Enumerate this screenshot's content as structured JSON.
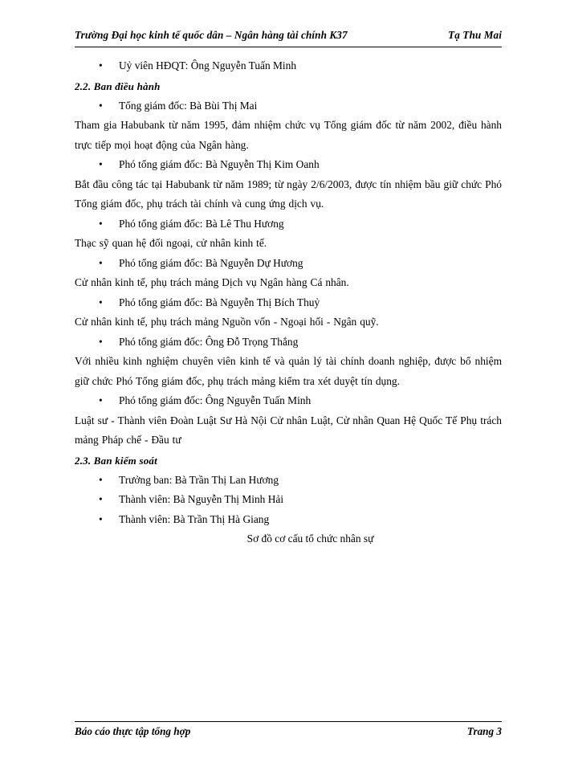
{
  "header": {
    "left": "Trường Đại học kinh tế quốc dân – Ngân hàng tài chính K37",
    "right": "Tạ Thu Mai"
  },
  "footer": {
    "left": "Báo cáo thực tập tổng hợp",
    "right": "Trang 3"
  },
  "bullet_glyph": "•",
  "body": {
    "b_uy_vien": "Uỷ viên HĐQT: Ông Nguyễn Tuấn Minh",
    "h_2_2": "2.2. Ban điều hành",
    "b_tong_giam_doc": "Tổng giám đốc: Bà Bùi Thị Mai",
    "p_tham_gia": "Tham gia Habubank từ năm 1995, đảm nhiệm chức vụ Tổng giám đốc từ năm 2002, điều hành trực tiếp mọi hoạt động của Ngân hàng.",
    "b_kim_oanh": "Phó tổng giám đốc: Bà Nguyễn Thị Kim Oanh",
    "p_bat_dau": "Bắt đầu công tác tại Habubank từ năm 1989; từ ngày 2/6/2003, được tín nhiệm bầu giữ chức Phó Tổng giám đốc, phụ trách tài chính và cung ứng dịch vụ.",
    "b_le_thu_huong": "Phó tổng giám đốc: Bà Lê Thu Hương",
    "p_thac_sy": "Thạc sỹ quan hệ đối ngoại, cử nhân kinh tế.",
    "b_du_huong": "Phó tổng giám đốc: Bà Nguyễn Dự Hương",
    "p_cu_nhan_1": "Cử nhân kinh tế, phụ trách mảng Dịch vụ Ngân hàng Cá nhân.",
    "b_bich_thuy": "Phó tổng giám đốc: Bà Nguyễn Thị Bích Thuỷ",
    "p_cu_nhan_2": "Cử nhân kinh tế, phụ trách mảng Nguồn vốn - Ngoại hối - Ngân quỹ.",
    "b_trong_thang": "Phó tổng giám đốc: Ông Đỗ Trọng Thắng",
    "p_voi_nhieu": "Với nhiều kinh nghiệm chuyên viên kinh tế và quản lý tài chính doanh nghiệp, được bổ nhiệm giữ chức Phó Tổng giám đốc, phụ trách mảng kiểm tra xét duyệt tín dụng.",
    "b_tuan_minh": "Phó tổng giám đốc: Ông Nguyễn Tuấn Minh",
    "p_luat_su": "Luật sư - Thành viên Đoàn Luật Sư Hà Nội Cử nhân Luật, Cử nhân Quan Hệ Quốc Tế Phụ trách mảng Pháp chế - Đầu tư",
    "h_2_3": "2.3. Ban kiểm soát",
    "b_truong_ban": "Trưởng ban: Bà Trần Thị Lan Hương",
    "b_minh_hai": "Thành viên: Bà Nguyễn Thị Minh Hải",
    "b_ha_giang": "Thành viên: Bà Trần Thị Hà Giang",
    "caption_so_do": "Sơ đồ cơ cấu tổ chức nhân sự"
  }
}
